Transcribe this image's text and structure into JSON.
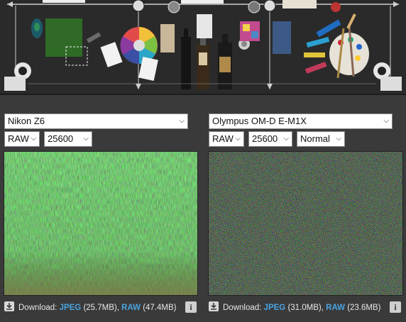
{
  "left": {
    "camera": "Nikon Z6",
    "format": "RAW",
    "iso": "25600",
    "download_label": "Download:",
    "jpeg_label": "JPEG",
    "jpeg_size": "(25.7MB)",
    "raw_label": "RAW",
    "raw_size": "(47.4MB)",
    "sep": ",",
    "info": "i"
  },
  "right": {
    "camera": "Olympus OM-D E-M1X",
    "format": "RAW",
    "iso": "25600",
    "mode": "Normal",
    "download_label": "Download:",
    "jpeg_label": "JPEG",
    "jpeg_size": "(31.0MB)",
    "raw_label": "RAW",
    "raw_size": "(23.6MB)",
    "sep": ",",
    "info": "i"
  },
  "colors": {
    "background": "#3a3a3a",
    "link": "#4aa3e0",
    "scene_bg": "#262626"
  }
}
